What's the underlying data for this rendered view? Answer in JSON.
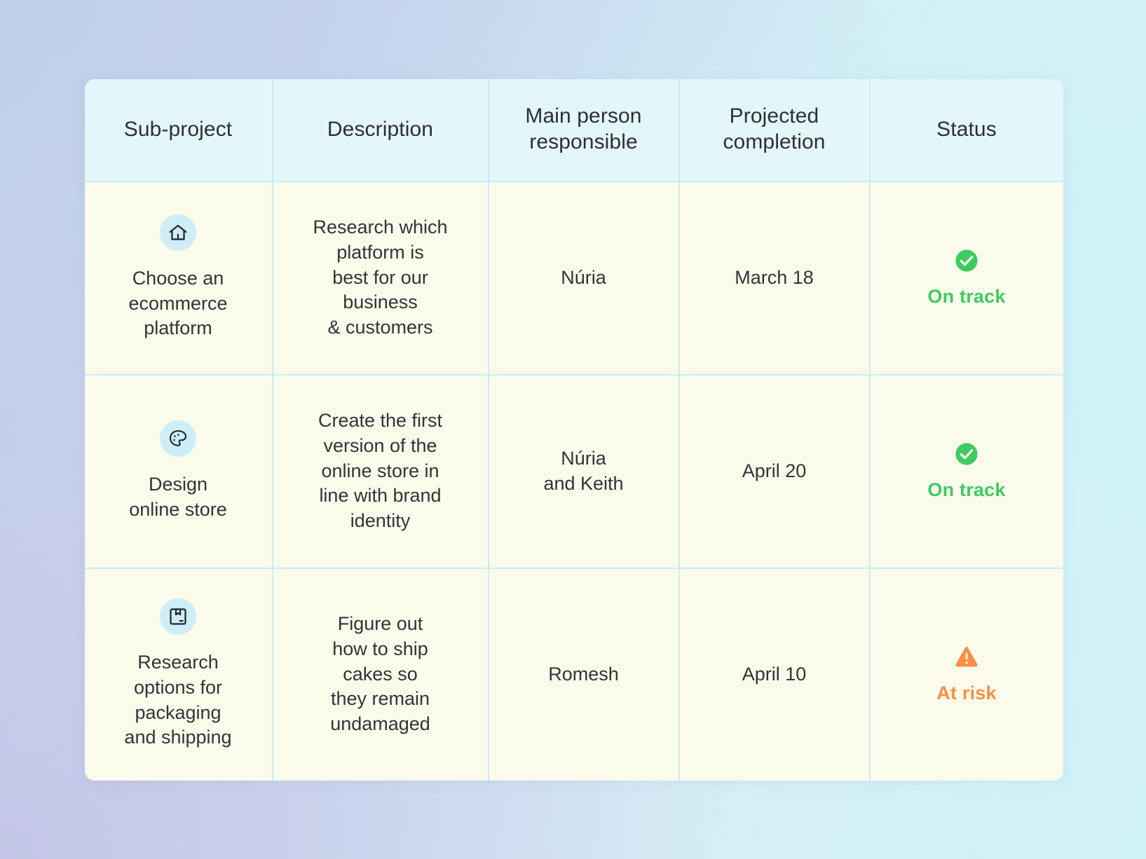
{
  "table": {
    "headers": [
      {
        "label": "Sub-project",
        "name": "sub-project"
      },
      {
        "label": "Description",
        "name": "description"
      },
      {
        "label": "Main person\nresponsible",
        "line1": "Main person",
        "line2": "responsible",
        "name": "main-person-responsible"
      },
      {
        "label": "Projected\ncompletion",
        "line1": "Projected",
        "line2": "completion",
        "name": "projected-completion"
      },
      {
        "label": "Status",
        "name": "status"
      }
    ],
    "rows": [
      {
        "icon": "home-icon",
        "sub_project": "Choose an\necommerce\nplatform",
        "sub_project_lines": [
          "Choose an",
          "ecommerce",
          "platform"
        ],
        "description": "Research which\nplatform is\nbest for our\nbusiness\n& customers",
        "description_lines": [
          "Research which",
          "platform is",
          "best for our",
          "business",
          "& customers"
        ],
        "person": "Núria",
        "person_lines": [
          "Núria"
        ],
        "completion": "March 18",
        "status_label": "On track",
        "status_icon": "check-circle-icon",
        "status_color": "#3fcb60"
      },
      {
        "icon": "palette-icon",
        "sub_project": "Design\nonline store",
        "sub_project_lines": [
          "Design",
          "online store"
        ],
        "description": "Create the first\nversion of the\nonline store in\nline with brand\nidentity",
        "description_lines": [
          "Create the first",
          "version of the",
          "online store in",
          "line with brand",
          "identity"
        ],
        "person": "Núria\nand Keith",
        "person_lines": [
          "Núria",
          "and Keith"
        ],
        "completion": "April 20",
        "status_label": "On track",
        "status_icon": "check-circle-icon",
        "status_color": "#3fcb60"
      },
      {
        "icon": "package-box-icon",
        "sub_project": "Research\noptions for\npackaging\nand shipping",
        "sub_project_lines": [
          "Research",
          "options for",
          "packaging",
          "and shipping"
        ],
        "description": "Figure out\nhow to ship\ncakes so\nthey remain\nundamaged",
        "description_lines": [
          "Figure out",
          "how to ship",
          "cakes so",
          "they remain",
          "undamaged"
        ],
        "person": "Romesh",
        "person_lines": [
          "Romesh"
        ],
        "completion": "April 10",
        "status_label": "At risk",
        "status_icon": "warning-triangle-icon",
        "status_color": "#f89044"
      }
    ]
  },
  "colors": {
    "header_bg": "#e3f7fb",
    "body_bg": "#fbfbeb",
    "border": "#c9ecf5",
    "icon_badge_bg": "#cdeef8",
    "text": "#33333a",
    "status_ok": "#3fcb60",
    "status_risk": "#f89044"
  }
}
